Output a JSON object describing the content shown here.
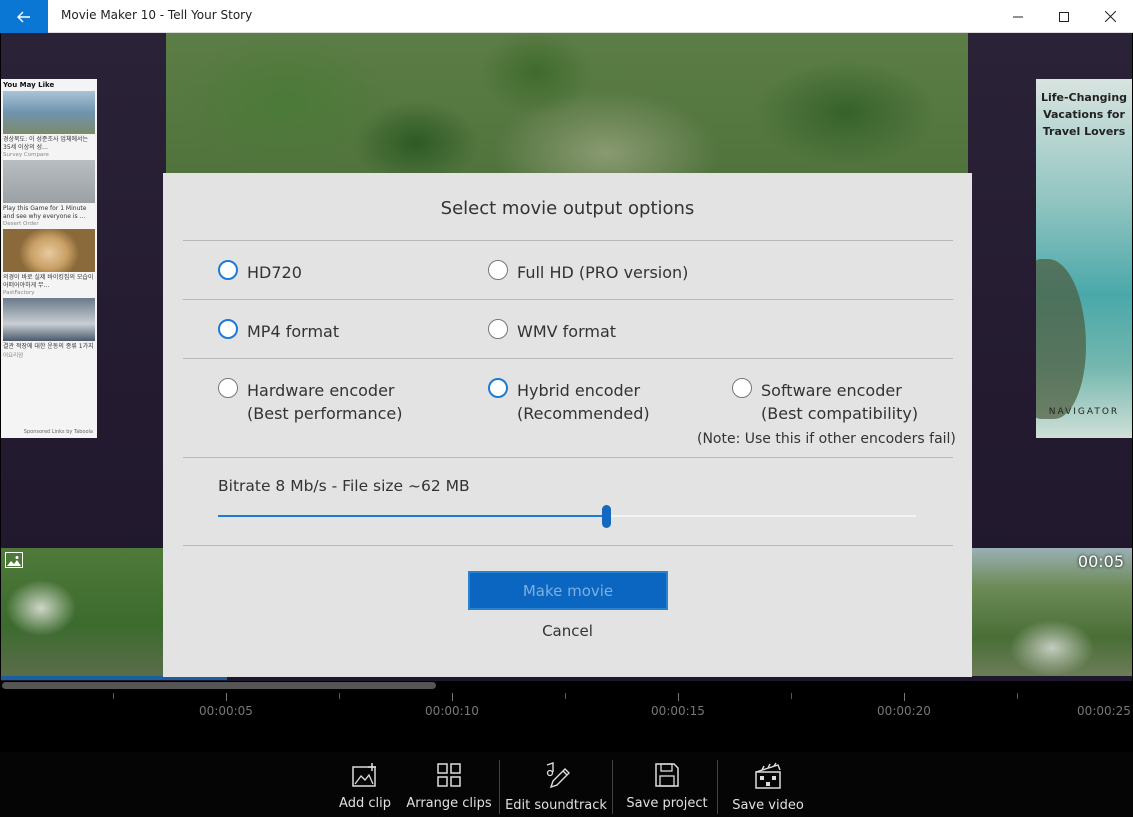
{
  "window": {
    "title": "Movie Maker 10 - Tell Your Story"
  },
  "ads": {
    "left": {
      "heading": "You May Like",
      "items": [
        {
          "text": "경상북도: 이 성준조사 업체에서는 35세 이상의 성…",
          "source": "Survey Compare"
        },
        {
          "text": "Play this Game for 1 Minute and see why everyone is …",
          "source": "Desert Order"
        },
        {
          "text": "의경이 바로 실제 바이킹집의 모습이 어떠어야하게 무…",
          "source": "PastFactory"
        },
        {
          "text": "결관 적장에 대한 운동의 종류 1가지",
          "source": "어요리얌"
        }
      ],
      "footer": "Sponsored Links by Taboola"
    },
    "right": {
      "headline": "Life-Changing Vacations for Travel Lovers",
      "brand": "NAVIGATOR"
    }
  },
  "timeline": {
    "clip_time": "00:05",
    "ticks": [
      "00:00:05",
      "00:00:10",
      "00:00:15",
      "00:00:20",
      "00:00:25"
    ]
  },
  "toolbar": {
    "add_clip": "Add clip",
    "arrange_clips": "Arrange clips",
    "edit_soundtrack": "Edit soundtrack",
    "save_project": "Save project",
    "save_video": "Save video"
  },
  "dialog": {
    "title": "Select movie output options",
    "resolution": {
      "hd720": "HD720",
      "fullhd": "Full HD (PRO version)",
      "selected": "hd720"
    },
    "format": {
      "mp4": "MP4 format",
      "wmv": "WMV format",
      "selected": "mp4"
    },
    "encoder": {
      "hardware_line1": "Hardware encoder",
      "hardware_line2": "(Best performance)",
      "hybrid_line1": "Hybrid encoder",
      "hybrid_line2": "(Recommended)",
      "software_line1": "Software encoder",
      "software_line2": "(Best compatibility)",
      "software_note": "(Note: Use this if other encoders fail)",
      "selected": "hybrid"
    },
    "bitrate_label": "Bitrate 8 Mb/s - File size ~62 MB",
    "bitrate_fraction": 0.556,
    "make_movie": "Make movie",
    "cancel": "Cancel"
  },
  "colors": {
    "accent": "#0a77d4",
    "button": "#0a66c0",
    "dialog_bg": "#e3e3e3"
  }
}
